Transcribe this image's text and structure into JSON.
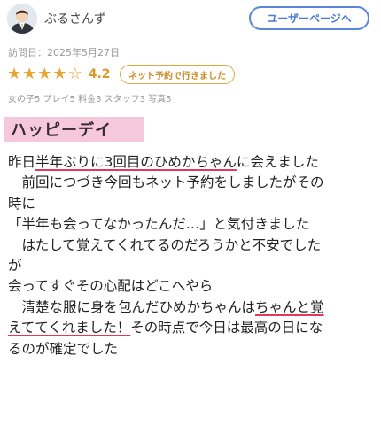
{
  "user": {
    "name": "ぶるさんず",
    "page_button": "ユーザーページへ"
  },
  "review": {
    "visit_date": "訪問日：2025年5月27日",
    "rating": 4.2,
    "rating_text": "4.2",
    "stars_filled": 4,
    "stars_total": 5,
    "badge": "ネット予約で行きました",
    "stats": "女の子5 プレイ5 料金3 スタッフ3 写真5",
    "title": "ハッピーデイ",
    "lines": [
      {
        "a": "昨日",
        "u": "半年ぶりに3回目のひめかちゃん",
        "b": "に会えました"
      },
      {
        "a": "　前回につづき今回もネット予約をしましたがその"
      },
      {
        "a": "時に"
      },
      {
        "a": "「半年も会ってなかったんだ…」と気付きました"
      },
      {
        "a": "　はたして覚えてくれてるのだろうかと不安でした"
      },
      {
        "a": "が"
      },
      {
        "a": "会ってすぐその心配はどこへやら"
      },
      {
        "a": "　清楚な服に身を包んだひめかちゃんは",
        "u": "ちゃんと覚"
      },
      {
        "u": "えててくれました！",
        "b": "その時点で今日は最高の日にな"
      },
      {
        "a": "るのが確定でした"
      }
    ]
  },
  "colors": {
    "accent_blue": "#4a7bd3",
    "star_gold": "#e6a431",
    "title_pink": "#f6c8dc",
    "underline_red": "#e2385a"
  }
}
